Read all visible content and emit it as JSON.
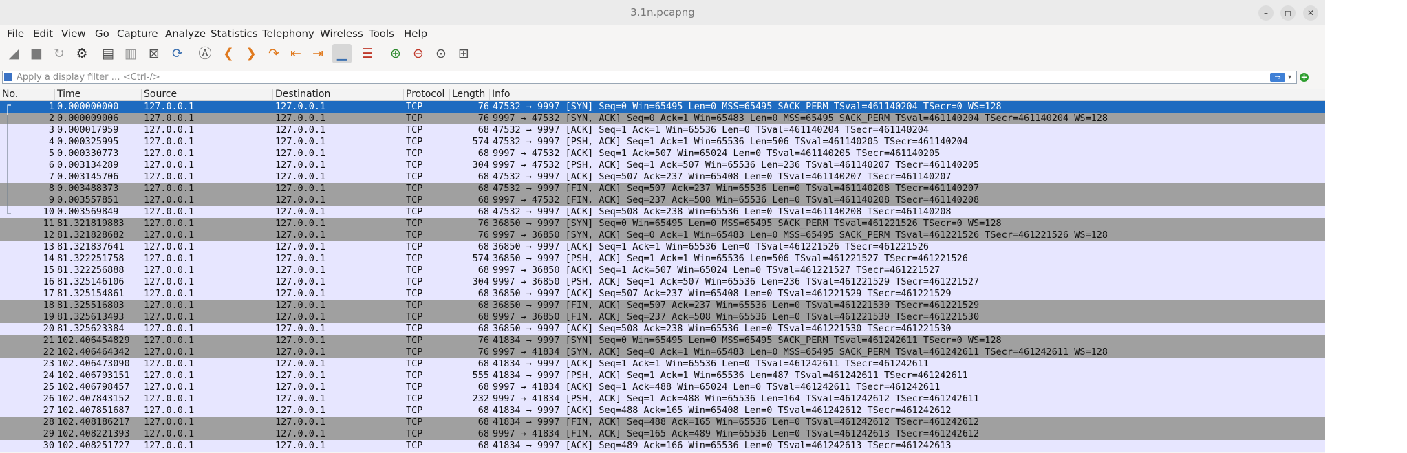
{
  "window": {
    "title": "3.1n.pcapng"
  },
  "window_controls": {
    "minimize": "–",
    "maximize": "◻",
    "close": "✕"
  },
  "menu": [
    "File",
    "Edit",
    "View",
    "Go",
    "Capture",
    "Analyze",
    "Statistics",
    "Telephony",
    "Wireless",
    "Tools",
    "Help"
  ],
  "toolbar": [
    {
      "name": "start-capture-icon",
      "glyph": "◢",
      "color": "#7a7a7a"
    },
    {
      "name": "stop-capture-icon",
      "glyph": "■",
      "color": "#7a7a7a"
    },
    {
      "name": "restart-capture-icon",
      "glyph": "↻",
      "color": "#9a9a9a"
    },
    {
      "name": "capture-options-icon",
      "glyph": "⚙",
      "color": "#333333"
    },
    {
      "name": "open-file-icon",
      "glyph": "▤",
      "color": "#555555"
    },
    {
      "name": "save-file-icon",
      "glyph": "▥",
      "color": "#9a9a9a"
    },
    {
      "name": "close-file-icon",
      "glyph": "⊠",
      "color": "#555555"
    },
    {
      "name": "reload-file-icon",
      "glyph": "⟳",
      "color": "#3a6fb0"
    },
    {
      "name": "find-packet-icon",
      "glyph": "Ⓐ",
      "color": "#555555"
    },
    {
      "name": "go-back-icon",
      "glyph": "❮",
      "color": "#e07a1f"
    },
    {
      "name": "go-forward-icon",
      "glyph": "❯",
      "color": "#e07a1f"
    },
    {
      "name": "go-to-packet-icon",
      "glyph": "↷",
      "color": "#e07a1f"
    },
    {
      "name": "go-first-packet-icon",
      "glyph": "⇤",
      "color": "#e07a1f"
    },
    {
      "name": "go-last-packet-icon",
      "glyph": "⇥",
      "color": "#e07a1f"
    },
    {
      "name": "autoscroll-icon",
      "glyph": "▁",
      "color": "#3a6fb0"
    },
    {
      "name": "colorize-icon",
      "glyph": "☰",
      "color": "#c0392b"
    },
    {
      "name": "zoom-in-icon",
      "glyph": "⊕",
      "color": "#2d8a2d"
    },
    {
      "name": "zoom-out-icon",
      "glyph": "⊖",
      "color": "#c0392b"
    },
    {
      "name": "normal-size-icon",
      "glyph": "⊙",
      "color": "#555555"
    },
    {
      "name": "resize-columns-icon",
      "glyph": "⊞",
      "color": "#555555"
    }
  ],
  "filter": {
    "placeholder": "Apply a display filter … <Ctrl-/>",
    "value": "",
    "apply_glyph": "⇒",
    "dropdown_glyph": "▾",
    "add_glyph": "+"
  },
  "columns": [
    {
      "key": "no",
      "label": "No."
    },
    {
      "key": "time",
      "label": "Time"
    },
    {
      "key": "source",
      "label": "Source"
    },
    {
      "key": "destination",
      "label": "Destination"
    },
    {
      "key": "protocol",
      "label": "Protocol"
    },
    {
      "key": "length",
      "label": "Length"
    },
    {
      "key": "info",
      "label": "Info"
    }
  ],
  "colors": {
    "selected": "#1e6bc0",
    "tcp_row": "#e7e6ff",
    "syn_fin_row": "#a0a0a0"
  },
  "packets": [
    {
      "no": "1",
      "time": "0.000000000",
      "source": "127.0.0.1",
      "destination": "127.0.0.1",
      "protocol": "TCP",
      "length": "76",
      "info": "47532 → 9997 [SYN] Seq=0 Win=65495 Len=0 MSS=65495 SACK_PERM TSval=461140204 TSecr=0 WS=128",
      "style": "sel"
    },
    {
      "no": "2",
      "time": "0.000009006",
      "source": "127.0.0.1",
      "destination": "127.0.0.1",
      "protocol": "TCP",
      "length": "76",
      "info": "9997 → 47532 [SYN, ACK] Seq=0 Ack=1 Win=65483 Len=0 MSS=65495 SACK_PERM TSval=461140204 TSecr=461140204 WS=128",
      "style": "fin"
    },
    {
      "no": "3",
      "time": "0.000017959",
      "source": "127.0.0.1",
      "destination": "127.0.0.1",
      "protocol": "TCP",
      "length": "68",
      "info": "47532 → 9997 [ACK] Seq=1 Ack=1 Win=65536 Len=0 TSval=461140204 TSecr=461140204",
      "style": "light"
    },
    {
      "no": "4",
      "time": "0.000325995",
      "source": "127.0.0.1",
      "destination": "127.0.0.1",
      "protocol": "TCP",
      "length": "574",
      "info": "47532 → 9997 [PSH, ACK] Seq=1 Ack=1 Win=65536 Len=506 TSval=461140205 TSecr=461140204",
      "style": "light"
    },
    {
      "no": "5",
      "time": "0.000330773",
      "source": "127.0.0.1",
      "destination": "127.0.0.1",
      "protocol": "TCP",
      "length": "68",
      "info": "9997 → 47532 [ACK] Seq=1 Ack=507 Win=65024 Len=0 TSval=461140205 TSecr=461140205",
      "style": "light"
    },
    {
      "no": "6",
      "time": "0.003134289",
      "source": "127.0.0.1",
      "destination": "127.0.0.1",
      "protocol": "TCP",
      "length": "304",
      "info": "9997 → 47532 [PSH, ACK] Seq=1 Ack=507 Win=65536 Len=236 TSval=461140207 TSecr=461140205",
      "style": "light"
    },
    {
      "no": "7",
      "time": "0.003145706",
      "source": "127.0.0.1",
      "destination": "127.0.0.1",
      "protocol": "TCP",
      "length": "68",
      "info": "47532 → 9997 [ACK] Seq=507 Ack=237 Win=65408 Len=0 TSval=461140207 TSecr=461140207",
      "style": "light"
    },
    {
      "no": "8",
      "time": "0.003488373",
      "source": "127.0.0.1",
      "destination": "127.0.0.1",
      "protocol": "TCP",
      "length": "68",
      "info": "47532 → 9997 [FIN, ACK] Seq=507 Ack=237 Win=65536 Len=0 TSval=461140208 TSecr=461140207",
      "style": "fin"
    },
    {
      "no": "9",
      "time": "0.003557851",
      "source": "127.0.0.1",
      "destination": "127.0.0.1",
      "protocol": "TCP",
      "length": "68",
      "info": "9997 → 47532 [FIN, ACK] Seq=237 Ack=508 Win=65536 Len=0 TSval=461140208 TSecr=461140208",
      "style": "fin"
    },
    {
      "no": "10",
      "time": "0.003569849",
      "source": "127.0.0.1",
      "destination": "127.0.0.1",
      "protocol": "TCP",
      "length": "68",
      "info": "47532 → 9997 [ACK] Seq=508 Ack=238 Win=65536 Len=0 TSval=461140208 TSecr=461140208",
      "style": "light"
    },
    {
      "no": "11",
      "time": "81.321819883",
      "source": "127.0.0.1",
      "destination": "127.0.0.1",
      "protocol": "TCP",
      "length": "76",
      "info": "36850 → 9997 [SYN] Seq=0 Win=65495 Len=0 MSS=65495 SACK_PERM TSval=461221526 TSecr=0 WS=128",
      "style": "fin"
    },
    {
      "no": "12",
      "time": "81.321828682",
      "source": "127.0.0.1",
      "destination": "127.0.0.1",
      "protocol": "TCP",
      "length": "76",
      "info": "9997 → 36850 [SYN, ACK] Seq=0 Ack=1 Win=65483 Len=0 MSS=65495 SACK_PERM TSval=461221526 TSecr=461221526 WS=128",
      "style": "fin"
    },
    {
      "no": "13",
      "time": "81.321837641",
      "source": "127.0.0.1",
      "destination": "127.0.0.1",
      "protocol": "TCP",
      "length": "68",
      "info": "36850 → 9997 [ACK] Seq=1 Ack=1 Win=65536 Len=0 TSval=461221526 TSecr=461221526",
      "style": "light"
    },
    {
      "no": "14",
      "time": "81.322251758",
      "source": "127.0.0.1",
      "destination": "127.0.0.1",
      "protocol": "TCP",
      "length": "574",
      "info": "36850 → 9997 [PSH, ACK] Seq=1 Ack=1 Win=65536 Len=506 TSval=461221527 TSecr=461221526",
      "style": "light"
    },
    {
      "no": "15",
      "time": "81.322256888",
      "source": "127.0.0.1",
      "destination": "127.0.0.1",
      "protocol": "TCP",
      "length": "68",
      "info": "9997 → 36850 [ACK] Seq=1 Ack=507 Win=65024 Len=0 TSval=461221527 TSecr=461221527",
      "style": "light"
    },
    {
      "no": "16",
      "time": "81.325146106",
      "source": "127.0.0.1",
      "destination": "127.0.0.1",
      "protocol": "TCP",
      "length": "304",
      "info": "9997 → 36850 [PSH, ACK] Seq=1 Ack=507 Win=65536 Len=236 TSval=461221529 TSecr=461221527",
      "style": "light"
    },
    {
      "no": "17",
      "time": "81.325154861",
      "source": "127.0.0.1",
      "destination": "127.0.0.1",
      "protocol": "TCP",
      "length": "68",
      "info": "36850 → 9997 [ACK] Seq=507 Ack=237 Win=65408 Len=0 TSval=461221529 TSecr=461221529",
      "style": "light"
    },
    {
      "no": "18",
      "time": "81.325516803",
      "source": "127.0.0.1",
      "destination": "127.0.0.1",
      "protocol": "TCP",
      "length": "68",
      "info": "36850 → 9997 [FIN, ACK] Seq=507 Ack=237 Win=65536 Len=0 TSval=461221530 TSecr=461221529",
      "style": "fin"
    },
    {
      "no": "19",
      "time": "81.325613493",
      "source": "127.0.0.1",
      "destination": "127.0.0.1",
      "protocol": "TCP",
      "length": "68",
      "info": "9997 → 36850 [FIN, ACK] Seq=237 Ack=508 Win=65536 Len=0 TSval=461221530 TSecr=461221530",
      "style": "fin"
    },
    {
      "no": "20",
      "time": "81.325623384",
      "source": "127.0.0.1",
      "destination": "127.0.0.1",
      "protocol": "TCP",
      "length": "68",
      "info": "36850 → 9997 [ACK] Seq=508 Ack=238 Win=65536 Len=0 TSval=461221530 TSecr=461221530",
      "style": "light"
    },
    {
      "no": "21",
      "time": "102.406454829",
      "source": "127.0.0.1",
      "destination": "127.0.0.1",
      "protocol": "TCP",
      "length": "76",
      "info": "41834 → 9997 [SYN] Seq=0 Win=65495 Len=0 MSS=65495 SACK_PERM TSval=461242611 TSecr=0 WS=128",
      "style": "fin"
    },
    {
      "no": "22",
      "time": "102.406464342",
      "source": "127.0.0.1",
      "destination": "127.0.0.1",
      "protocol": "TCP",
      "length": "76",
      "info": "9997 → 41834 [SYN, ACK] Seq=0 Ack=1 Win=65483 Len=0 MSS=65495 SACK_PERM TSval=461242611 TSecr=461242611 WS=128",
      "style": "fin"
    },
    {
      "no": "23",
      "time": "102.406473090",
      "source": "127.0.0.1",
      "destination": "127.0.0.1",
      "protocol": "TCP",
      "length": "68",
      "info": "41834 → 9997 [ACK] Seq=1 Ack=1 Win=65536 Len=0 TSval=461242611 TSecr=461242611",
      "style": "light"
    },
    {
      "no": "24",
      "time": "102.406793151",
      "source": "127.0.0.1",
      "destination": "127.0.0.1",
      "protocol": "TCP",
      "length": "555",
      "info": "41834 → 9997 [PSH, ACK] Seq=1 Ack=1 Win=65536 Len=487 TSval=461242611 TSecr=461242611",
      "style": "light"
    },
    {
      "no": "25",
      "time": "102.406798457",
      "source": "127.0.0.1",
      "destination": "127.0.0.1",
      "protocol": "TCP",
      "length": "68",
      "info": "9997 → 41834 [ACK] Seq=1 Ack=488 Win=65024 Len=0 TSval=461242611 TSecr=461242611",
      "style": "light"
    },
    {
      "no": "26",
      "time": "102.407843152",
      "source": "127.0.0.1",
      "destination": "127.0.0.1",
      "protocol": "TCP",
      "length": "232",
      "info": "9997 → 41834 [PSH, ACK] Seq=1 Ack=488 Win=65536 Len=164 TSval=461242612 TSecr=461242611",
      "style": "light"
    },
    {
      "no": "27",
      "time": "102.407851687",
      "source": "127.0.0.1",
      "destination": "127.0.0.1",
      "protocol": "TCP",
      "length": "68",
      "info": "41834 → 9997 [ACK] Seq=488 Ack=165 Win=65408 Len=0 TSval=461242612 TSecr=461242612",
      "style": "light"
    },
    {
      "no": "28",
      "time": "102.408186217",
      "source": "127.0.0.1",
      "destination": "127.0.0.1",
      "protocol": "TCP",
      "length": "68",
      "info": "41834 → 9997 [FIN, ACK] Seq=488 Ack=165 Win=65536 Len=0 TSval=461242612 TSecr=461242612",
      "style": "fin"
    },
    {
      "no": "29",
      "time": "102.408221393",
      "source": "127.0.0.1",
      "destination": "127.0.0.1",
      "protocol": "TCP",
      "length": "68",
      "info": "9997 → 41834 [FIN, ACK] Seq=165 Ack=489 Win=65536 Len=0 TSval=461242613 TSecr=461242612",
      "style": "fin"
    },
    {
      "no": "30",
      "time": "102.408251727",
      "source": "127.0.0.1",
      "destination": "127.0.0.1",
      "protocol": "TCP",
      "length": "68",
      "info": "41834 → 9997 [ACK] Seq=489 Ack=166 Win=65536 Len=0 TSval=461242613 TSecr=461242613",
      "style": "light"
    }
  ]
}
